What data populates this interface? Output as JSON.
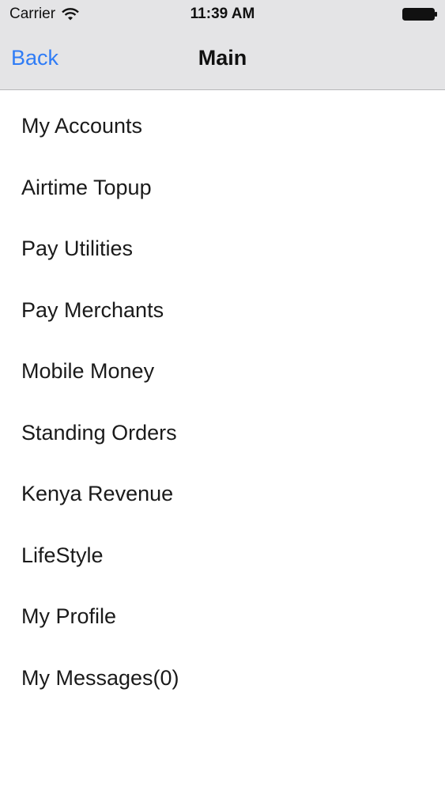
{
  "status_bar": {
    "carrier": "Carrier",
    "time": "11:39 AM",
    "wifi_icon": "wifi-icon",
    "battery_icon": "battery-icon"
  },
  "nav_bar": {
    "back_label": "Back",
    "title": "Main",
    "accent_color": "#2f7cf6",
    "background_color": "#e4e4e6"
  },
  "menu": {
    "items": [
      {
        "label": "My Accounts"
      },
      {
        "label": "Airtime Topup"
      },
      {
        "label": "Pay Utilities"
      },
      {
        "label": "Pay Merchants"
      },
      {
        "label": "Mobile Money"
      },
      {
        "label": "Standing Orders"
      },
      {
        "label": "Kenya Revenue"
      },
      {
        "label": "LifeStyle"
      },
      {
        "label": "My Profile"
      },
      {
        "label": "My Messages(0)"
      }
    ]
  }
}
